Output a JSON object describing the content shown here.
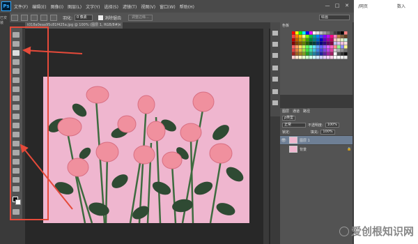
{
  "menubar": {
    "logo": "Ps",
    "items": [
      "文件(F)",
      "编辑(E)",
      "图像(I)",
      "图层(L)",
      "文字(Y)",
      "选择(S)",
      "滤镜(T)",
      "视图(V)",
      "窗口(W)",
      "帮助(H)"
    ],
    "window_controls": [
      "—",
      "□",
      "✕"
    ]
  },
  "options_bar": {
    "feather_label": "羽化:",
    "feather_value": "0 像素",
    "antialias_label": "消除锯齿",
    "refine_edge_button": "调整边缘...",
    "workspace": "绘画"
  },
  "document": {
    "tab_title": "t018a0eaa95c81f425a.jpg @ 100% (图层 1, RGB/8#)",
    "close": "×"
  },
  "right_page": {
    "tab_text": "/网页",
    "tab_text2": "数入"
  },
  "edge_text": "已安装",
  "swatches_panel": {
    "tabs": [
      "色板"
    ],
    "colors": [
      "#ff0000",
      "#ffff00",
      "#00ff00",
      "#00ffff",
      "#0000ff",
      "#ff00ff",
      "#ffffff",
      "#e0e0e0",
      "#c0c0c0",
      "#a0a0a0",
      "#808080",
      "#606060",
      "#404040",
      "#202020",
      "#000000",
      "#ff8080",
      "#ff4040",
      "#ff8000",
      "#ffc000",
      "#ffff80",
      "#80ff00",
      "#00c040",
      "#00a0a0",
      "#0080ff",
      "#4040ff",
      "#8000ff",
      "#c000ff",
      "#ff0080",
      "#ff80c0",
      "#c08040",
      "#806040",
      "#604020",
      "#c00000",
      "#c06000",
      "#c0a000",
      "#a0c000",
      "#40a000",
      "#008040",
      "#008080",
      "#0060c0",
      "#0000c0",
      "#6000c0",
      "#a000a0",
      "#c00060",
      "#f0c0c0",
      "#f0e0c0",
      "#e0f0c0",
      "#c0f0e0",
      "#800000",
      "#804000",
      "#806000",
      "#608000",
      "#206000",
      "#004020",
      "#004040",
      "#003080",
      "#000080",
      "#300080",
      "#600060",
      "#800040",
      "#c0c0f0",
      "#e0c0f0",
      "#f0c0e0",
      "#ffe0e0",
      "#ff6060",
      "#ffa060",
      "#ffe060",
      "#c0ff60",
      "#60ff60",
      "#60ffc0",
      "#60e0ff",
      "#60a0ff",
      "#6060ff",
      "#a060ff",
      "#e060ff",
      "#ff60c0",
      "#ff9090",
      "#90ff90",
      "#9090ff",
      "#ffff90",
      "#e04040",
      "#e08040",
      "#e0c040",
      "#a0e040",
      "#40e040",
      "#40e0a0",
      "#40c0e0",
      "#4080e0",
      "#4040e0",
      "#8040e0",
      "#c040e0",
      "#e040a0",
      "#d0d0d0",
      "#b0b0b0",
      "#909090",
      "#707070",
      "#a02020",
      "#a06020",
      "#a08020",
      "#80a020",
      "#20a020",
      "#20a080",
      "#2080a0",
      "#2060a0",
      "#2020a0",
      "#6020a0",
      "#a020a0",
      "#a02060",
      "#f8f8f8",
      "#505050",
      "#303030",
      "#101010",
      "#ffd0d0",
      "#ffe8d0",
      "#fff8d0",
      "#e8ffd0",
      "#d0ffd0",
      "#d0ffe8",
      "#d0f8ff",
      "#d0e8ff",
      "#d0d0ff",
      "#e8d0ff",
      "#f8d0ff",
      "#ffd0e8",
      "#ffffff",
      "#fafafa",
      "#f0f0f0",
      "#e8e8e8"
    ]
  },
  "layers_panel": {
    "tabs": [
      "图层",
      "通道",
      "路径"
    ],
    "kind_label": "ρ类型",
    "blend_mode": "正常",
    "opacity_label": "不透明度:",
    "opacity_value": "100%",
    "lock_label": "锁定:",
    "fill_label": "填充:",
    "fill_value": "100%",
    "layers": [
      {
        "name": "图层 1",
        "selected": true
      },
      {
        "name": "背景",
        "selected": false
      }
    ]
  },
  "watermark": {
    "text": "爱创根知识网"
  },
  "colors": {
    "annotation_red": "#e64a3a",
    "photo_pink": "#efb6cf",
    "rose_pink": "#f0909e",
    "leaf_green": "#2f4a33"
  }
}
